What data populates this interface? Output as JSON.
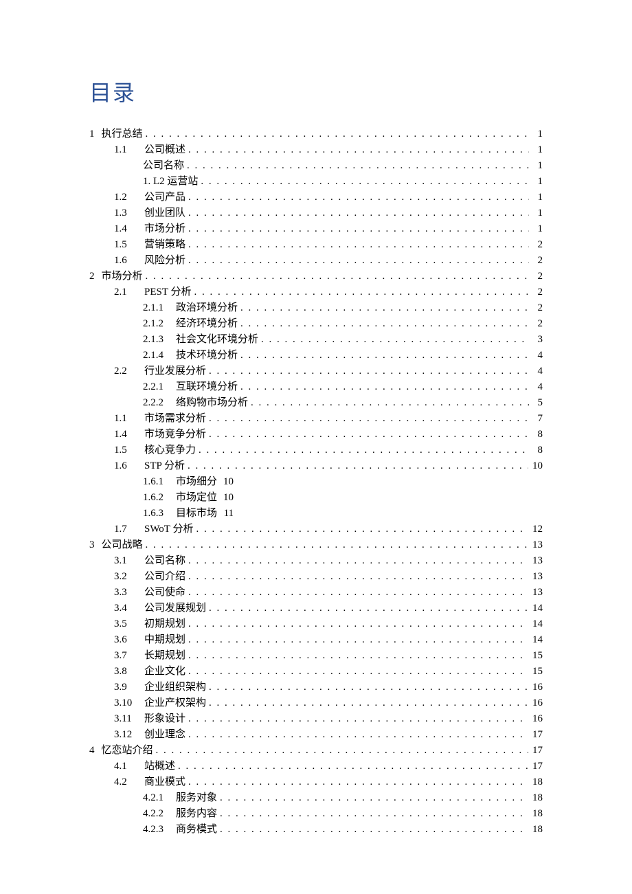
{
  "title": "目录",
  "entries": [
    {
      "level": 1,
      "num": "1",
      "text": "执行总结",
      "page": "1",
      "dots": true
    },
    {
      "level": 2,
      "num": "1.1",
      "text": "公司概述",
      "page": "1",
      "dots": true
    },
    {
      "level": 3,
      "num": "",
      "text": "公司名称",
      "page": "1",
      "dots": true
    },
    {
      "level": 3,
      "num": "",
      "text": "1. L2 运营站",
      "page": "1",
      "dots": true
    },
    {
      "level": 2,
      "num": "1.2",
      "text": "公司产品",
      "page": "1",
      "dots": true
    },
    {
      "level": 2,
      "num": "1.3",
      "text": "创业团队",
      "page": "1",
      "dots": true
    },
    {
      "level": 2,
      "num": "1.4",
      "text": "市场分析",
      "page": "1",
      "dots": true
    },
    {
      "level": 2,
      "num": "1.5",
      "text": "营销策略",
      "page": "2",
      "dots": true
    },
    {
      "level": 2,
      "num": "1.6",
      "text": "风险分析",
      "page": "2",
      "dots": true
    },
    {
      "level": 1,
      "num": "2",
      "text": "市场分析",
      "page": "2",
      "dots": true
    },
    {
      "level": 2,
      "num": "2.1",
      "text": "PEST 分析",
      "page": "2",
      "dots": true
    },
    {
      "level": 3,
      "num": "2.1.1",
      "text": "政治环境分析",
      "page": "2",
      "dots": true
    },
    {
      "level": 3,
      "num": "2.1.2",
      "text": "经济环境分析",
      "page": "2",
      "dots": true
    },
    {
      "level": 3,
      "num": "2.1.3",
      "text": "社会文化环境分析",
      "page": "3",
      "dots": true
    },
    {
      "level": 3,
      "num": "2.1.4",
      "text": "技术环境分析",
      "page": "4",
      "dots": true
    },
    {
      "level": 2,
      "num": "2.2",
      "text": "行业发展分析",
      "page": "4",
      "dots": true
    },
    {
      "level": 3,
      "num": "2.2.1",
      "text": "互联环境分析",
      "page": "4",
      "dots": true
    },
    {
      "level": 3,
      "num": "2.2.2",
      "text": "络购物市场分析",
      "page": "5",
      "dots": true
    },
    {
      "level": 2,
      "num": "1.1",
      "text": "市场需求分析",
      "page": "7",
      "dots": true
    },
    {
      "level": 2,
      "num": "1.4",
      "text": "市场竞争分析",
      "page": "8",
      "dots": true
    },
    {
      "level": 2,
      "num": "1.5",
      "text": "核心竞争力",
      "page": "8",
      "dots": true
    },
    {
      "level": 2,
      "num": "1.6",
      "text": "STP 分析",
      "page": "10",
      "dots": true
    },
    {
      "level": 3,
      "num": "1.6.1",
      "text": "市场细分",
      "page": "10",
      "dots": false
    },
    {
      "level": 3,
      "num": "1.6.2",
      "text": "市场定位",
      "page": "10",
      "dots": false
    },
    {
      "level": 3,
      "num": "1.6.3",
      "text": "目标市场",
      "page": "11",
      "dots": false
    },
    {
      "level": 2,
      "num": "1.7",
      "text": "SWoT 分析",
      "page": "12",
      "dots": true
    },
    {
      "level": 1,
      "num": "3",
      "text": "公司战略",
      "page": "13",
      "dots": true
    },
    {
      "level": 2,
      "num": "3.1",
      "text": "公司名称",
      "page": "13",
      "dots": true
    },
    {
      "level": 2,
      "num": "3.2",
      "text": "公司介绍",
      "page": "13",
      "dots": true
    },
    {
      "level": 2,
      "num": "3.3",
      "text": "公司使命",
      "page": "13",
      "dots": true
    },
    {
      "level": 2,
      "num": "3.4",
      "text": "公司发展规划",
      "page": "14",
      "dots": true
    },
    {
      "level": 2,
      "num": "3.5",
      "text": "初期规划",
      "page": "14",
      "dots": true
    },
    {
      "level": 2,
      "num": "3.6",
      "text": "中期规划",
      "page": "14",
      "dots": true
    },
    {
      "level": 2,
      "num": "3.7",
      "text": "长期规划",
      "page": "15",
      "dots": true
    },
    {
      "level": 2,
      "num": "3.8",
      "text": "企业文化",
      "page": "15",
      "dots": true
    },
    {
      "level": 2,
      "num": "3.9",
      "text": "企业组织架构",
      "page": "16",
      "dots": true
    },
    {
      "level": 2,
      "num": "3.10",
      "text": "企业产权架构",
      "page": "16",
      "dots": true
    },
    {
      "level": 2,
      "num": "3.11",
      "text": "形象设计",
      "page": "16",
      "dots": true
    },
    {
      "level": 2,
      "num": "3.12",
      "text": "创业理念",
      "page": "17",
      "dots": true
    },
    {
      "level": 1,
      "num": "4",
      "text": "忆恋站介绍",
      "page": "17",
      "dots": true
    },
    {
      "level": 2,
      "num": "4.1",
      "text": "站概述",
      "page": "17",
      "dots": true
    },
    {
      "level": 2,
      "num": "4.2",
      "text": "商业模式",
      "page": "18",
      "dots": true
    },
    {
      "level": 3,
      "num": "4.2.1",
      "text": "服务对象",
      "page": "18",
      "dots": true
    },
    {
      "level": 3,
      "num": "4.2.2",
      "text": "服务内容",
      "page": "18",
      "dots": true
    },
    {
      "level": 3,
      "num": "4.2.3",
      "text": "商务模式",
      "page": "18",
      "dots": true
    }
  ]
}
